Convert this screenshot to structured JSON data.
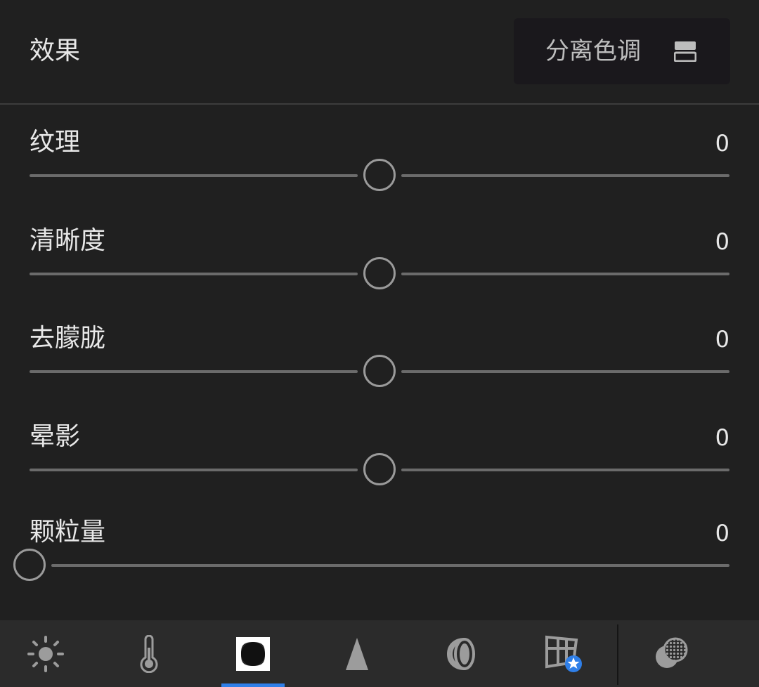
{
  "header": {
    "title": "效果",
    "mode_label": "分离色调",
    "mode_icon": "panel-list-icon"
  },
  "sliders": [
    {
      "label": "纹理",
      "value": "0",
      "position": 0.5
    },
    {
      "label": "清晰度",
      "value": "0",
      "position": 0.5
    },
    {
      "label": "去朦胧",
      "value": "0",
      "position": 0.5
    },
    {
      "label": "晕影",
      "value": "0",
      "position": 0.5
    },
    {
      "label": "颗粒量",
      "value": "0",
      "position": 0.0
    }
  ],
  "toolbar": {
    "active_tool": "effects",
    "tools": [
      {
        "id": "light",
        "icon": "sun-icon"
      },
      {
        "id": "color",
        "icon": "thermometer-icon"
      },
      {
        "id": "effects",
        "icon": "vignette-icon"
      },
      {
        "id": "detail",
        "icon": "triangle-icon"
      },
      {
        "id": "optics",
        "icon": "lens-icon"
      },
      {
        "id": "geometry",
        "icon": "perspective-grid-icon"
      },
      {
        "id": "presets",
        "icon": "overlapping-circles-icon"
      }
    ]
  },
  "colors": {
    "background": "#202020",
    "toolbar": "#2b2b2b",
    "accent": "#2f7fe8"
  }
}
